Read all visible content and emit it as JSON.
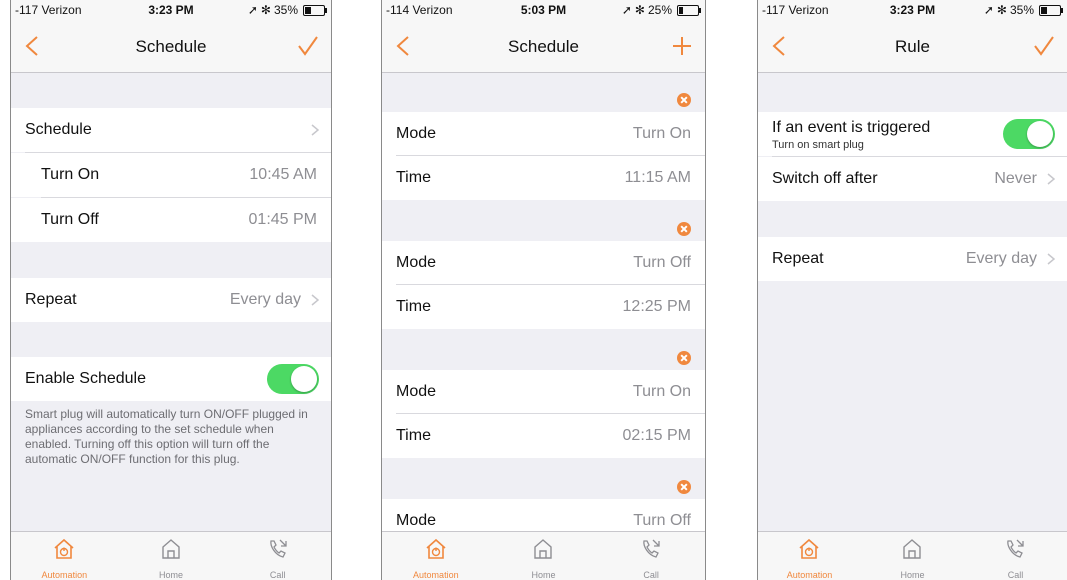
{
  "colors": {
    "accent": "#f0883e",
    "toggle_on": "#4cd964",
    "secondary_text": "#8e8e93"
  },
  "screen1": {
    "status": {
      "carrier": "-117 Verizon",
      "time": "3:23 PM",
      "battery": "35%",
      "battery_level": 0.35
    },
    "nav": {
      "title": "Schedule",
      "left_icon": "back-chevron-icon",
      "right_icon": "checkmark-icon"
    },
    "schedule_label": "Schedule",
    "turn_on_label": "Turn On",
    "turn_on_time": "10:45 AM",
    "turn_off_label": "Turn Off",
    "turn_off_time": "01:45 PM",
    "repeat_label": "Repeat",
    "repeat_value": "Every day",
    "enable_label": "Enable Schedule",
    "enable_on": true,
    "note": "Smart plug will automatically turn ON/OFF plugged in appliances according to the set schedule when enabled. Turning off this option will turn off the automatic ON/OFF function for this plug."
  },
  "screen2": {
    "status": {
      "carrier": "-114 Verizon",
      "time": "5:03 PM",
      "battery": "25%",
      "battery_level": 0.25
    },
    "nav": {
      "title": "Schedule",
      "left_icon": "back-chevron-icon",
      "right_icon": "plus-icon"
    },
    "entries": [
      {
        "mode_label": "Mode",
        "mode": "Turn On",
        "time_label": "Time",
        "time": "11:15 AM"
      },
      {
        "mode_label": "Mode",
        "mode": "Turn Off",
        "time_label": "Time",
        "time": "12:25 PM"
      },
      {
        "mode_label": "Mode",
        "mode": "Turn On",
        "time_label": "Time",
        "time": "02:15 PM"
      },
      {
        "mode_label": "Mode",
        "mode": "Turn Off"
      }
    ]
  },
  "screen3": {
    "status": {
      "carrier": "-117 Verizon",
      "time": "3:23 PM",
      "battery": "35%",
      "battery_level": 0.35
    },
    "nav": {
      "title": "Rule",
      "left_icon": "back-chevron-icon",
      "right_icon": "checkmark-icon"
    },
    "event_label": "If an event is triggered",
    "event_sub": "Turn on smart plug",
    "event_on": true,
    "switch_off_label": "Switch off after",
    "switch_off_value": "Never",
    "repeat_label": "Repeat",
    "repeat_value": "Every day"
  },
  "tabs": [
    {
      "label": "Automation",
      "icon": "automation-home-icon",
      "active": true
    },
    {
      "label": "Home",
      "icon": "home-icon",
      "active": false
    },
    {
      "label": "Call",
      "icon": "call-icon",
      "active": false
    }
  ]
}
